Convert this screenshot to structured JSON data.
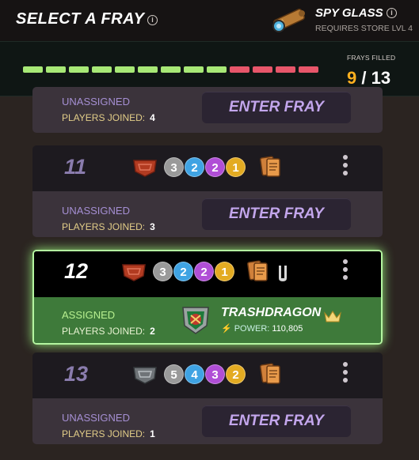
{
  "header": {
    "title": "SELECT A FRAY",
    "info_glyph": "i"
  },
  "spyglass": {
    "title": "SPY GLASS",
    "info_glyph": "i",
    "subtitle": "REQUIRES STORE LVL 4",
    "icon": "spyglass-icon"
  },
  "progress": {
    "label": "FRAYS FILLED",
    "filled": "9",
    "separator": "/",
    "total": "13",
    "filled_count": 9,
    "total_count": 13,
    "filled_color": "#a7e876",
    "empty_color": "#e7566a"
  },
  "frays": [
    {
      "number": "",
      "status": "UNASSIGNED",
      "players_label": "PLAYERS JOINED:",
      "players": "4",
      "button": "ENTER FRAY"
    },
    {
      "number": "11",
      "league_icon": "bronze-shield-icon",
      "pips": [
        "3",
        "2",
        "2",
        "1"
      ],
      "status": "UNASSIGNED",
      "players_label": "PLAYERS JOINED:",
      "players": "3",
      "button": "ENTER FRAY"
    },
    {
      "number": "12",
      "league_icon": "bronze-shield-icon",
      "pips": [
        "3",
        "2",
        "2",
        "1"
      ],
      "status": "ASSIGNED",
      "players_label": "PLAYERS JOINED:",
      "players": "2",
      "player_name": "TRASHDRAGON",
      "power_label": "POWER:",
      "power_value": "110,805"
    },
    {
      "number": "13",
      "league_icon": "silver-shield-icon",
      "pips": [
        "5",
        "4",
        "3",
        "2"
      ],
      "status": "UNASSIGNED",
      "players_label": "PLAYERS JOINED:",
      "players": "1",
      "button": "ENTER FRAY"
    }
  ],
  "pip_colors": [
    "#9a9a9a",
    "#3fa3e3",
    "#b04ed6",
    "#e3ab22"
  ],
  "colors": {
    "accent_purple": "#c3a6ec",
    "assigned_green": "#3e7a3a",
    "gold": "#ffb01f"
  }
}
